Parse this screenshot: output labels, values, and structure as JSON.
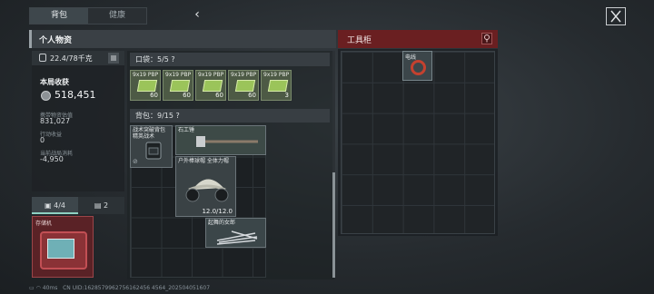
{
  "tabs": [
    {
      "label": "背包",
      "active": true
    },
    {
      "label": "健康",
      "active": false
    }
  ],
  "personal": {
    "title": "个人物资",
    "weight": "22.4/78千克",
    "earnings_title": "本局收获",
    "earnings_value": "518,451",
    "carried_value_label": "携带物资估值",
    "carried_value": "831,027",
    "action_income_label": "行动收益",
    "action_income": "0",
    "current_loss_label": "当前战局消耗",
    "current_loss": "-4,950"
  },
  "loadout_tabs": [
    {
      "label": "4/4",
      "icon": "toolbox-icon",
      "active": true
    },
    {
      "label": "2",
      "icon": "ammo-box-icon",
      "active": false
    }
  ],
  "device": {
    "label": "存储机"
  },
  "pocket": {
    "label": "口袋：5/5",
    "help": "?",
    "items": [
      {
        "name": "9x19 PBP",
        "count": "60"
      },
      {
        "name": "9x19 PBP",
        "count": "60"
      },
      {
        "name": "9x19 PBP",
        "count": "60"
      },
      {
        "name": "9x19 PBP",
        "count": "60"
      },
      {
        "name": "9x19 PBP",
        "count": "3"
      }
    ]
  },
  "backpack": {
    "label": "背包：9/15",
    "help": "?",
    "items": [
      {
        "name": "战术突破背包 精英战术"
      },
      {
        "name": "石工锤"
      },
      {
        "name": "户外棒球帽 全体力帽"
      },
      {
        "name": "起舞的女郎"
      }
    ],
    "helmet_durability": "12.0/12.0"
  },
  "cabinet": {
    "title": "工具柜",
    "items": [
      {
        "name": "电线"
      }
    ]
  },
  "status": {
    "ping": "40ms",
    "uid": "CN UID:1628579962756162456 4564_202504051607"
  },
  "colors": {
    "cabinet_header": "#6a1f21",
    "ammo_green": "#9bc45a",
    "device_red": "#8a3236",
    "wire_red": "#c4412f"
  }
}
